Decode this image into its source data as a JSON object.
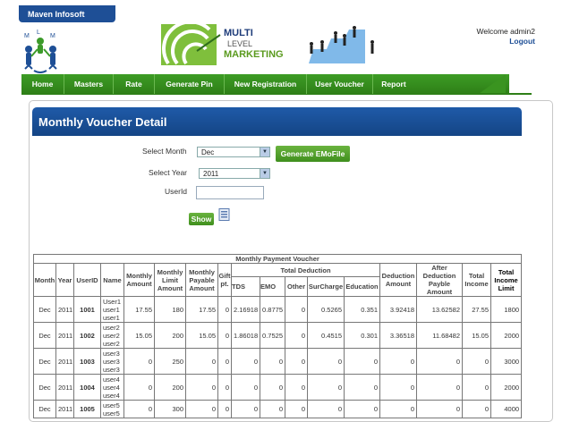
{
  "brand": {
    "name": "Maven Infosoft"
  },
  "logo": {
    "letters": [
      "M",
      "L",
      "M"
    ]
  },
  "banner": {
    "line1": "MULTI",
    "line2": "LEVEL",
    "line3": "MARKETING"
  },
  "user": {
    "welcome": "Welcome admin2",
    "logout": "Logout"
  },
  "nav": {
    "items": [
      "Home",
      "Masters",
      "Rate",
      "Generate Pin",
      "New Registration",
      "User Voucher",
      "Report"
    ]
  },
  "page": {
    "title": "Monthly Voucher Detail"
  },
  "form": {
    "month_label": "Select Month",
    "month_value": "Dec",
    "year_label": "Select Year",
    "year_value": "2011",
    "userid_label": "UserId",
    "userid_value": "",
    "generate_button": "Generate EMoFile",
    "show_button": "Show"
  },
  "table": {
    "caption": "Monthly Payment Voucher",
    "headers": {
      "month": "Month",
      "year": "Year",
      "userid": "UserID",
      "name": "Name",
      "monthly_amount": "Monthly Amount",
      "monthly_limit": "Monthly Limit Amount",
      "monthly_payable": "Monthly Payable Amount",
      "gift": "Gift pt.",
      "total_deduction": "Total Deduction",
      "tds": "TDS",
      "emo": "EMO",
      "other": "Other",
      "surcharge": "SurCharge",
      "education": "Education",
      "deduction_amount": "Deduction Amount",
      "after_deduction": "After Deduction Payble Amount",
      "total_income": "Total Income",
      "total_income_limit": "Total Income Limit"
    },
    "rows": [
      {
        "month": "Dec",
        "year": "2011",
        "userid": "1001",
        "name": [
          "User1",
          "user1",
          "user1"
        ],
        "monthly_amount": "17.55",
        "monthly_limit": "180",
        "monthly_payable": "17.55",
        "gift": "0",
        "tds": "2.16918",
        "emo": "0.8775",
        "other": "0",
        "surcharge": "0.5265",
        "education": "0.351",
        "deduction_amount": "3.92418",
        "after_deduction": "13.62582",
        "total_income": "27.55",
        "total_income_limit": "1800"
      },
      {
        "month": "Dec",
        "year": "2011",
        "userid": "1002",
        "name": [
          "user2",
          "user2",
          "user2"
        ],
        "monthly_amount": "15.05",
        "monthly_limit": "200",
        "monthly_payable": "15.05",
        "gift": "0",
        "tds": "1.86018",
        "emo": "0.7525",
        "other": "0",
        "surcharge": "0.4515",
        "education": "0.301",
        "deduction_amount": "3.36518",
        "after_deduction": "11.68482",
        "total_income": "15.05",
        "total_income_limit": "2000"
      },
      {
        "month": "Dec",
        "year": "2011",
        "userid": "1003",
        "name": [
          "user3",
          "user3",
          "user3"
        ],
        "monthly_amount": "0",
        "monthly_limit": "250",
        "monthly_payable": "0",
        "gift": "0",
        "tds": "0",
        "emo": "0",
        "other": "0",
        "surcharge": "0",
        "education": "0",
        "deduction_amount": "0",
        "after_deduction": "0",
        "total_income": "0",
        "total_income_limit": "3000"
      },
      {
        "month": "Dec",
        "year": "2011",
        "userid": "1004",
        "name": [
          "user4",
          "user4",
          "user4"
        ],
        "monthly_amount": "0",
        "monthly_limit": "200",
        "monthly_payable": "0",
        "gift": "0",
        "tds": "0",
        "emo": "0",
        "other": "0",
        "surcharge": "0",
        "education": "0",
        "deduction_amount": "0",
        "after_deduction": "0",
        "total_income": "0",
        "total_income_limit": "2000"
      },
      {
        "month": "Dec",
        "year": "2011",
        "userid": "1005",
        "name": [
          "user5",
          "user5"
        ],
        "monthly_amount": "0",
        "monthly_limit": "300",
        "monthly_payable": "0",
        "gift": "0",
        "tds": "0",
        "emo": "0",
        "other": "0",
        "surcharge": "0",
        "education": "0",
        "deduction_amount": "0",
        "after_deduction": "0",
        "total_income": "0",
        "total_income_limit": "4000"
      }
    ]
  }
}
